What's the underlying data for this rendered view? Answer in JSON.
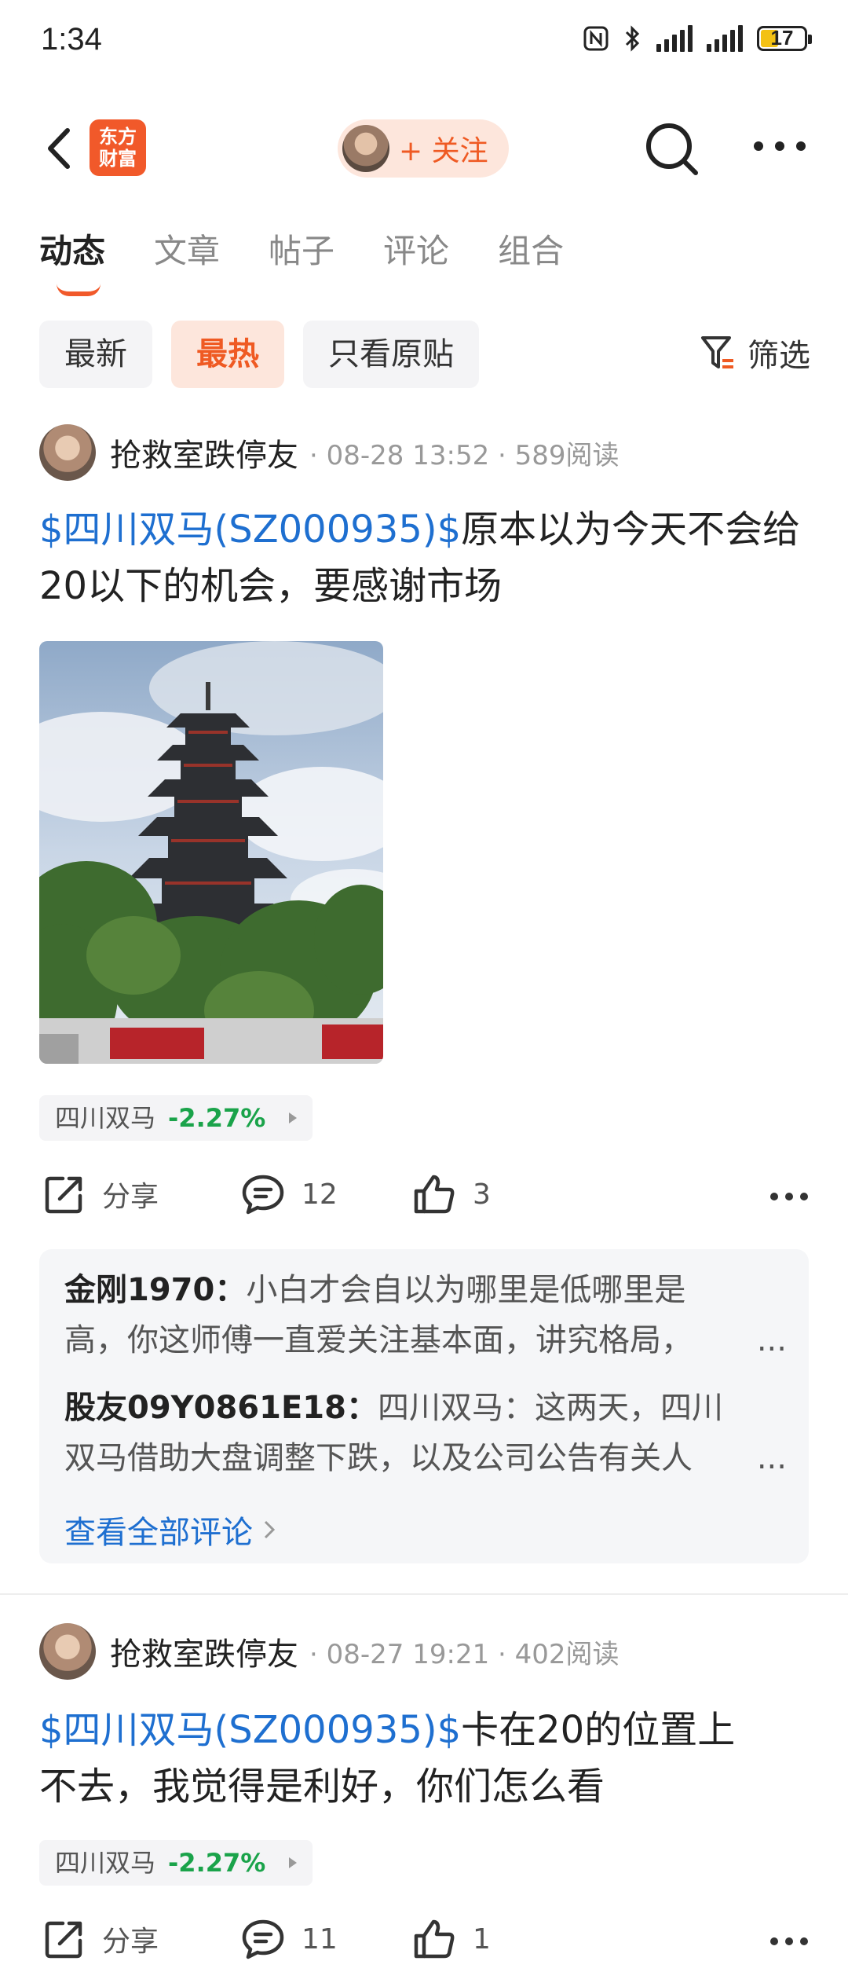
{
  "status_bar": {
    "time": "1:34",
    "battery": "17"
  },
  "nav": {
    "logo_text_line1": "东方",
    "logo_text_line2": "财富",
    "follow_label": "+ 关注"
  },
  "tabs": [
    {
      "label": "动态",
      "active": true
    },
    {
      "label": "文章"
    },
    {
      "label": "帖子"
    },
    {
      "label": "评论"
    },
    {
      "label": "组合"
    }
  ],
  "filters": [
    {
      "label": "最新"
    },
    {
      "label": "最热",
      "active": true
    },
    {
      "label": "只看原贴"
    }
  ],
  "filter_button": "筛选",
  "posts": [
    {
      "author": "抢救室跌停友",
      "date": "08-28 13:52",
      "reads": "589阅读",
      "stock_link": "$四川双马(SZ000935)$",
      "text": "原本以为今天不会给20以下的机会，要感谢市场",
      "stock_name": "四川双马",
      "stock_change": "-2.27%",
      "share_label": "分享",
      "comment_count": "12",
      "like_count": "3",
      "comments": [
        {
          "user": "金刚1970：",
          "text_line1": "小白才会自以为哪里是低哪里是",
          "text_line2": "高，你这师傅一直爱关注基本面，讲究格局，",
          "ellipsis": "..."
        },
        {
          "user": "股友09Y0861E18：",
          "text_line1": "四川双马：这两天，四川",
          "text_line2": "双马借助大盘调整下跌，以及公司公告有关人",
          "ellipsis": "..."
        }
      ],
      "see_all": "查看全部评论"
    },
    {
      "author": "抢救室跌停友",
      "date": "08-27 19:21",
      "reads": "402阅读",
      "stock_link": "$四川双马(SZ000935)$",
      "text_line1": "卡在20的位置上",
      "text_line2": "不去，我觉得是利好，你们怎么看",
      "stock_name": "四川双马",
      "stock_change": "-2.27%",
      "share_label": "分享",
      "comment_count": "11",
      "like_count": "1"
    }
  ]
}
